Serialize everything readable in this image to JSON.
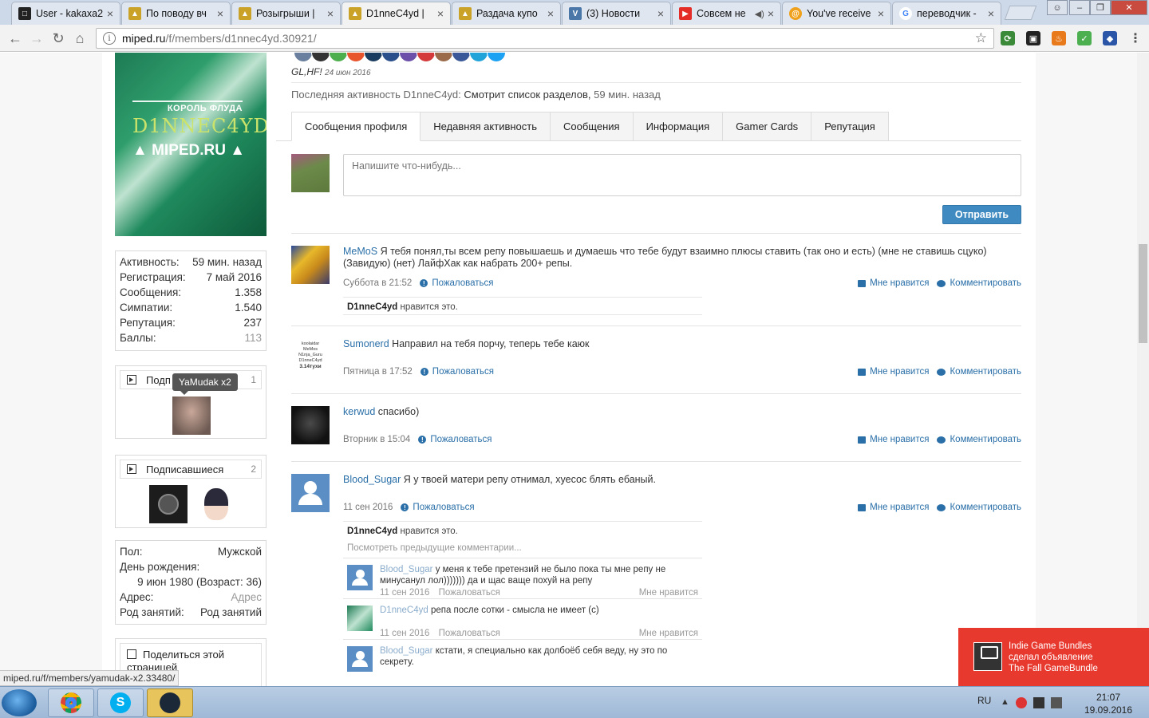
{
  "browser": {
    "tabs": [
      {
        "title": "User - kakaxa2",
        "active": false,
        "color": "#222222"
      },
      {
        "title": "По поводу вч",
        "active": false,
        "color": "#c9a227"
      },
      {
        "title": "Розыгрыши | ",
        "active": false,
        "color": "#c9a227"
      },
      {
        "title": "D1nneC4yd | ",
        "active": true,
        "color": "#c9a227"
      },
      {
        "title": "Раздача купо",
        "active": false,
        "color": "#c9a227"
      },
      {
        "title": "(3) Новости",
        "active": false,
        "color": "#4a76a8"
      },
      {
        "title": "Совсем не",
        "active": false,
        "color": "#e52d27"
      },
      {
        "title": "You've receive",
        "active": false,
        "color": "#f0a11c"
      },
      {
        "title": "переводчик -",
        "active": false,
        "color": "#4285f4"
      }
    ],
    "url_host": "miped.ru",
    "url_path": "/f/members/d1nnec4yd.30921/",
    "status_url": "miped.ru/f/members/yamudak-x2.33480/"
  },
  "sidebar": {
    "banner": {
      "small": "КОРОЛЬ ФЛУДА",
      "nick": "D1NNEC4YD",
      "site": "▲ MIPED.RU ▲"
    },
    "stats": [
      {
        "label": "Активность:",
        "value": "59 мин. назад",
        "muted": false
      },
      {
        "label": "Регистрация:",
        "value": "7 май 2016",
        "muted": false
      },
      {
        "label": "Сообщения:",
        "value": "1.358",
        "muted": false
      },
      {
        "label": "Симпатии:",
        "value": "1.540",
        "muted": false
      },
      {
        "label": "Репутация:",
        "value": "237",
        "muted": false
      },
      {
        "label": "Баллы:",
        "value": "113",
        "muted": true
      }
    ],
    "following": {
      "label": "Подп",
      "count": "1",
      "tooltip": "YaMudak x2"
    },
    "followers": {
      "label": "Подписавшиеся",
      "count": "2"
    },
    "info": [
      {
        "label": "Пол:",
        "value": "Мужской",
        "muted": false
      },
      {
        "label": "День рождения:",
        "value": "",
        "muted": false
      },
      {
        "label": "",
        "value": "9 июн 1980 (Возраст: 36)",
        "muted": false
      },
      {
        "label": "Адрес:",
        "value": "Адрес",
        "muted": true
      },
      {
        "label": "Род занятий:",
        "value": "Род занятий",
        "muted": false
      }
    ],
    "share": {
      "label": "Поделиться этой страницей"
    }
  },
  "profile": {
    "motto": "GL,HF!",
    "motto_date": "24 июн 2016",
    "last_activity_label": "Последняя активность D1nneC4yd:",
    "last_activity_text": "Смотрит список разделов,",
    "last_activity_time": "59 мин. назад",
    "tabs": [
      "Сообщения профиля",
      "Недавняя активность",
      "Сообщения",
      "Информация",
      "Gamer Cards",
      "Репутация"
    ],
    "composer_placeholder": "Напишите что-нибудь...",
    "send_label": "Отправить"
  },
  "labels": {
    "report": "Пожаловаться",
    "like": "Мне нравится",
    "comment": "Комментировать",
    "likes_suffix": "нравится это.",
    "view_previous": "Посмотреть предыдущие комментарии..."
  },
  "messages": [
    {
      "user": "MeMoS",
      "text": "Я тебя понял,ты всем репу повышаешь и думаешь что тебе будут взаимно плюсы ставить (так оно и есть) (мне не ставишь сцуко) (Завидую) (нет) ЛайфХак как набрать 200+ репы.",
      "time": "Суббота в 21:52",
      "liked_by": "D1nneC4yd"
    },
    {
      "user": "Sumonerd",
      "text": "Направил на тебя порчу, теперь тебе каюк",
      "time": "Пятница в 17:52",
      "liked_by": ""
    },
    {
      "user": "kerwud",
      "text": "спасибо)",
      "time": "Вторник в 15:04",
      "liked_by": ""
    },
    {
      "user": "Blood_Sugar",
      "text": "Я у твоей матери репу отнимал, хуесос блять ебаный.",
      "time": "11 сен 2016",
      "liked_by": "D1nneC4yd"
    }
  ],
  "sumonerd_avatar_lines": [
    "koolaidar",
    "MeMos",
    "N1nja_Guru",
    "D1nneC4yd",
    "3.14тухи"
  ],
  "comments": [
    {
      "user": "Blood_Sugar",
      "text": "у меня к тебе претензий не было пока ты мне репу не минусанул лол))))))) да и щас ваще похуй на репу",
      "time": "11 сен 2016"
    },
    {
      "user": "D1nneC4yd",
      "text": "репа после сотки - смысла не имеет (с)",
      "time": "11 сен 2016"
    },
    {
      "user": "Blood_Sugar",
      "text": "кстати, я специально как долбоёб себя веду, ну это по секрету.",
      "time": ""
    }
  ],
  "toast": {
    "line1": "Indie Game Bundles",
    "line2": "сделал объявление",
    "line3": "The Fall GameBundle"
  },
  "taskbar": {
    "lang": "RU",
    "time": "21:07",
    "date": "19.09.2016"
  },
  "colors": {
    "link": "#2a6fa8",
    "button": "#3f8ac0",
    "toast": "#e8392f"
  }
}
